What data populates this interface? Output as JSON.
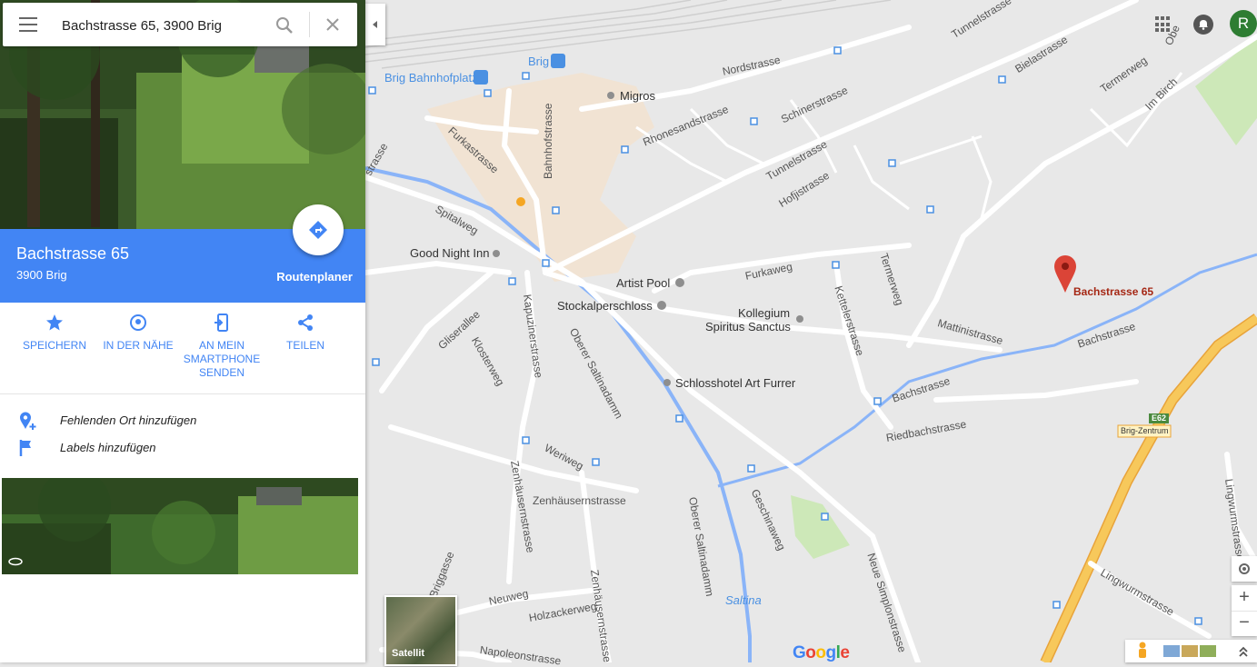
{
  "search": {
    "value": "Bachstrasse 65, 3900 Brig"
  },
  "place": {
    "title": "Bachstrasse 65",
    "subtitle": "3900 Brig",
    "directions_label": "Routenplaner"
  },
  "actions": [
    {
      "label": "SPEICHERN",
      "icon": "star-icon"
    },
    {
      "label": "IN DER NÄHE",
      "icon": "nearby-icon"
    },
    {
      "label": "AN MEIN SMARTPHONE SENDEN",
      "icon": "send-to-phone-icon"
    },
    {
      "label": "TEILEN",
      "icon": "share-icon"
    }
  ],
  "extra": {
    "add_place": "Fehlenden Ort hinzufügen",
    "add_labels": "Labels hinzufügen"
  },
  "map": {
    "pin_label": "Bachstrasse 65",
    "pois": {
      "brig": "Brig",
      "bahnhofplatz": "Brig Bahnhofplatz",
      "migros": "Migros",
      "good_night_inn": "Good Night Inn",
      "artist_pool": "Artist Pool",
      "stockalperschloss": "Stockalperschloss",
      "kollegium1": "Kollegium",
      "kollegium2": "Spiritus Sanctus",
      "schlosshotel": "Schlosshotel Art Furrer",
      "saltina": "Saltina"
    },
    "streets": {
      "nordstrasse": "Nordstrasse",
      "bielastrasse": "Bielastrasse",
      "tunnelstrasse": "Tunnelstrasse",
      "termerweg": "Termerweg",
      "im_birch": "Im Birch",
      "rhonesand": "Rhonesandstrasse",
      "schinerstrasse": "Schinerstrasse",
      "tunnelstrasse2": "Tunnelstrasse",
      "hofjistrasse": "Hofjistrasse",
      "furkastrasse": "Furkastrasse",
      "bahnhofstrasse": "Bahnhofstrasse",
      "spitalweg": "Spitalweg",
      "furkaweg": "Furkaweg",
      "kettelerstrasse": "Kettelerstrasse",
      "termerweg2": "Termerweg",
      "mattinistrasse": "Mattinistrasse",
      "bachstrasse1": "Bachstrasse",
      "bachstrasse2": "Bachstrasse",
      "riedbachstrasse": "Riedbachstrasse",
      "kapuzinerstrasse": "Kapuzinerstrasse",
      "oberer_saltinadamm": "Oberer Saltinadamm",
      "gliserallee": "Gliserallee",
      "klosterweg": "Klosterweg",
      "weriweg": "Weriweg",
      "zenhaeusern1": "Zenhäusernstrasse",
      "zenhaeusern2": "Zenhäusernstrasse",
      "zenhaeusern3": "Zenhäusernstrasse",
      "geschinaweg": "Geschinaweg",
      "oberer_saltinadamm2": "Oberer Saltinadamm",
      "neue_simplon": "Neue Simplonstrasse",
      "lingwurm1": "Lingwurmstrasse",
      "lingwurm2": "Lingwurmstrasse",
      "neuweg": "Neuweg",
      "holzackerweg": "Holzackerweg",
      "napoleonstrasse": "Napoleonstrasse",
      "briggasse": "Briggasse",
      "strasse_left": "strasse",
      "obere": "Obe"
    },
    "highway_shield": "E62",
    "highway_exit": "Brig-Zentrum",
    "satellite_label": "Satellit",
    "google_logo": "Google",
    "account_initial": "R"
  },
  "colors": {
    "accent": "#4285f4",
    "pin": "#db4437",
    "water": "#8ab4f8",
    "highway": "#f7b733",
    "park": "#cde8b8"
  }
}
